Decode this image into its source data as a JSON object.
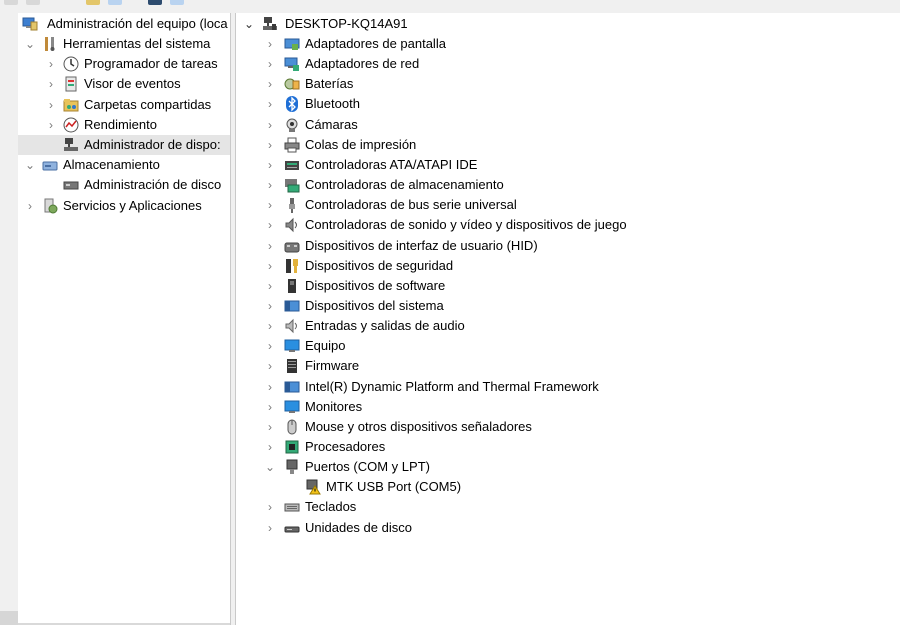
{
  "left_tree": {
    "root": "Administración del equipo (loca",
    "items": [
      {
        "label": "Herramientas del sistema",
        "expanded": true,
        "icon": "tools-icon"
      },
      {
        "label": "Programador de tareas",
        "icon": "clock-icon"
      },
      {
        "label": "Visor de eventos",
        "icon": "event-viewer-icon"
      },
      {
        "label": "Carpetas compartidas",
        "icon": "shared-folder-icon"
      },
      {
        "label": "Rendimiento",
        "icon": "performance-icon"
      },
      {
        "label": "Administrador de dispo:",
        "icon": "device-manager-icon",
        "selected": true
      },
      {
        "label": "Almacenamiento",
        "expanded": true,
        "icon": "storage-icon"
      },
      {
        "label": "Administración de disco",
        "icon": "disk-management-icon"
      },
      {
        "label": "Servicios y Aplicaciones",
        "icon": "services-icon"
      }
    ]
  },
  "right_tree": {
    "root": "DESKTOP-KQ14A91",
    "categories": [
      {
        "label": "Adaptadores de pantalla",
        "icon": "display-adapter-icon"
      },
      {
        "label": "Adaptadores de red",
        "icon": "network-adapter-icon"
      },
      {
        "label": "Baterías",
        "icon": "battery-icon"
      },
      {
        "label": "Bluetooth",
        "icon": "bluetooth-icon"
      },
      {
        "label": "Cámaras",
        "icon": "camera-icon"
      },
      {
        "label": "Colas de impresión",
        "icon": "printer-icon"
      },
      {
        "label": "Controladoras ATA/ATAPI IDE",
        "icon": "ide-controller-icon"
      },
      {
        "label": "Controladoras de almacenamiento",
        "icon": "storage-controller-icon"
      },
      {
        "label": "Controladoras de bus serie universal",
        "icon": "usb-icon"
      },
      {
        "label": "Controladoras de sonido y vídeo y dispositivos de juego",
        "icon": "sound-icon"
      },
      {
        "label": "Dispositivos de interfaz de usuario (HID)",
        "icon": "hid-icon"
      },
      {
        "label": "Dispositivos de seguridad",
        "icon": "security-device-icon"
      },
      {
        "label": "Dispositivos de software",
        "icon": "software-device-icon"
      },
      {
        "label": "Dispositivos del sistema",
        "icon": "system-device-icon"
      },
      {
        "label": "Entradas y salidas de audio",
        "icon": "audio-io-icon"
      },
      {
        "label": "Equipo",
        "icon": "computer-icon"
      },
      {
        "label": "Firmware",
        "icon": "firmware-icon"
      },
      {
        "label": "Intel(R) Dynamic Platform and Thermal Framework",
        "icon": "thermal-icon"
      },
      {
        "label": "Monitores",
        "icon": "monitor-icon"
      },
      {
        "label": "Mouse y otros dispositivos señaladores",
        "icon": "mouse-icon"
      },
      {
        "label": "Procesadores",
        "icon": "processor-icon"
      },
      {
        "label": "Puertos (COM y LPT)",
        "icon": "port-icon",
        "expanded": true,
        "children": [
          {
            "label": "MTK USB Port (COM5)",
            "icon": "warning-port-icon"
          }
        ]
      },
      {
        "label": "Teclados",
        "icon": "keyboard-icon"
      },
      {
        "label": "Unidades de disco",
        "icon": "disk-drive-icon"
      }
    ]
  }
}
